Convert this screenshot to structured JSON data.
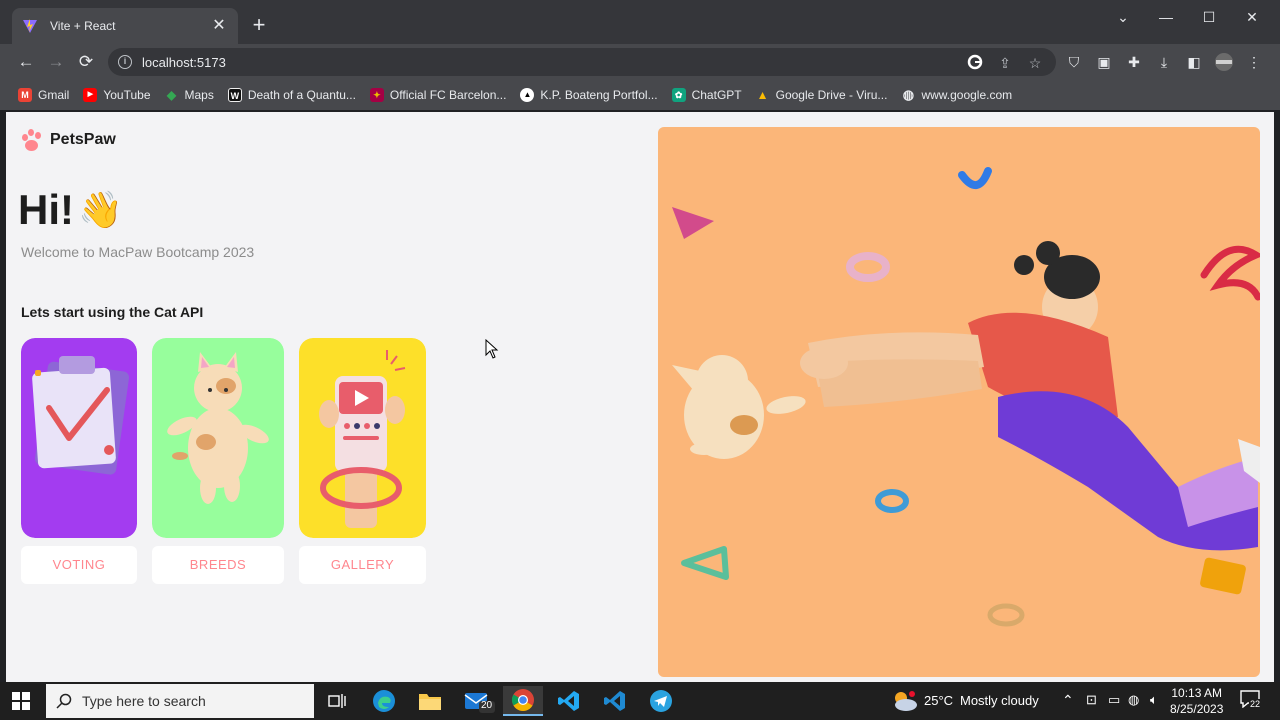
{
  "browser": {
    "tab_title": "Vite + React",
    "tab_close": "✕",
    "new_tab": "+",
    "url": "localhost:5173",
    "window_controls": {
      "minimize": "—",
      "maximize": "☐",
      "close": "✕"
    },
    "nav": {
      "back": "←",
      "forward": "→",
      "reload": "⟳",
      "info": "i"
    },
    "bookmarks": [
      {
        "label": "Gmail",
        "icon": "gmail-icon",
        "color": "#ea4335",
        "glyph": "M"
      },
      {
        "label": "YouTube",
        "icon": "youtube-icon",
        "color": "#ff0000",
        "glyph": "▶"
      },
      {
        "label": "Maps",
        "icon": "maps-icon",
        "color": "#34a853",
        "glyph": "◆"
      },
      {
        "label": "Death of a Quantu...",
        "icon": "w-icon",
        "color": "#111111",
        "glyph": "W"
      },
      {
        "label": "Official FC Barcelon...",
        "icon": "fcb-icon",
        "color": "#a50044",
        "glyph": "✦"
      },
      {
        "label": "K.P. Boateng Portfol...",
        "icon": "triangle-icon",
        "color": "#000000",
        "glyph": "▲"
      },
      {
        "label": "ChatGPT",
        "icon": "chatgpt-icon",
        "color": "#10a37f",
        "glyph": "✿"
      },
      {
        "label": "Google Drive - Viru...",
        "icon": "drive-icon",
        "color": "#fbbc04",
        "glyph": "▲"
      },
      {
        "label": "www.google.com",
        "icon": "globe-icon",
        "color": "#5f6368",
        "glyph": "◍"
      }
    ]
  },
  "page": {
    "logo_text": "PetsPaw",
    "greeting": "Hi!",
    "wave_emoji": "👋",
    "welcome": "Welcome to MacPaw Bootcamp 2023",
    "start_label": "Lets start using the Cat API",
    "cards": [
      {
        "label": "VOTING",
        "color": "#b982ff"
      },
      {
        "label": "BREEDS",
        "color": "#97eab9"
      },
      {
        "label": "GALLERY",
        "color": "#ffd280"
      }
    ],
    "colors": {
      "accent": "#ff868e",
      "hero_bg": "#fbb679",
      "page_bg": "#f3f3f5"
    }
  },
  "taskbar": {
    "search_placeholder": "Type here to search",
    "mail_badge": "20",
    "temperature": "25°C",
    "weather": "Mostly cloudy",
    "time": "10:13 AM",
    "date": "8/25/2023",
    "notifications": "22"
  }
}
